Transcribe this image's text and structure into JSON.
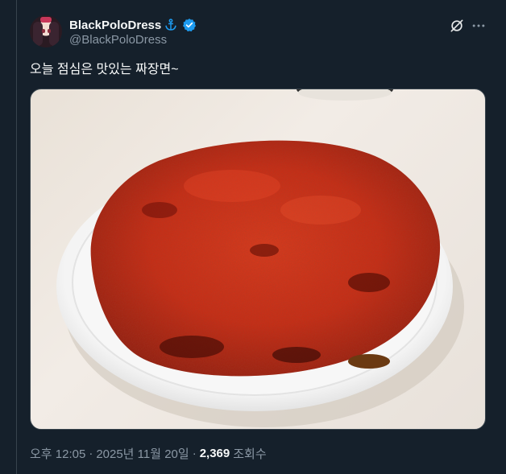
{
  "author": {
    "display_name": "BlackPoloDress",
    "handle": "@BlackPoloDress",
    "avatar_icon": "avatar",
    "badges": [
      "anchor-icon",
      "verified-icon"
    ]
  },
  "tweet": {
    "text": "오늘 점심은 맛있는 짜장면~",
    "time": "오후 12:05",
    "separator1": "·",
    "date": "2025년 11월 20일",
    "separator2": "·",
    "views_count": "2,369",
    "views_label": "조회수"
  },
  "colors": {
    "background": "#15202b",
    "text_primary": "#f7f9f9",
    "text_secondary": "#8b98a5",
    "verified": "#1d9bf0",
    "border": "#38444d"
  }
}
